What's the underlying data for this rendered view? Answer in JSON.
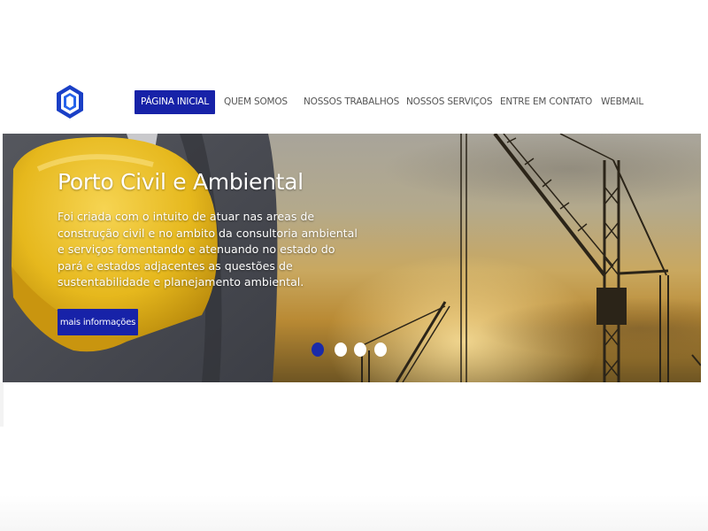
{
  "header": {
    "logo_icon": "hexagon-logo-icon",
    "brand_color": "#1722a8",
    "nav": [
      {
        "label": "PÁGINA INICIAL",
        "active": true
      },
      {
        "label": "QUEM SOMOS",
        "active": false
      },
      {
        "label": "NOSSOS TRABALHOS",
        "active": false
      },
      {
        "label": "NOSSOS SERVIÇOS",
        "active": false
      },
      {
        "label": "ENTRE EM CONTATO",
        "active": false
      },
      {
        "label": "WEBMAIL",
        "active": false
      }
    ]
  },
  "hero": {
    "title": "Porto Civil e Ambiental",
    "text": "Foi criada com o intuito de atuar nas areas de construção civil e no ambito da consultoria ambiental e serviços fomentando e atenuando no estado do pará e estados adjacentes as questões de sustentabilidade e planejamento ambiental.",
    "button_label": "mais informações",
    "slides": 4,
    "active_slide": 1
  }
}
